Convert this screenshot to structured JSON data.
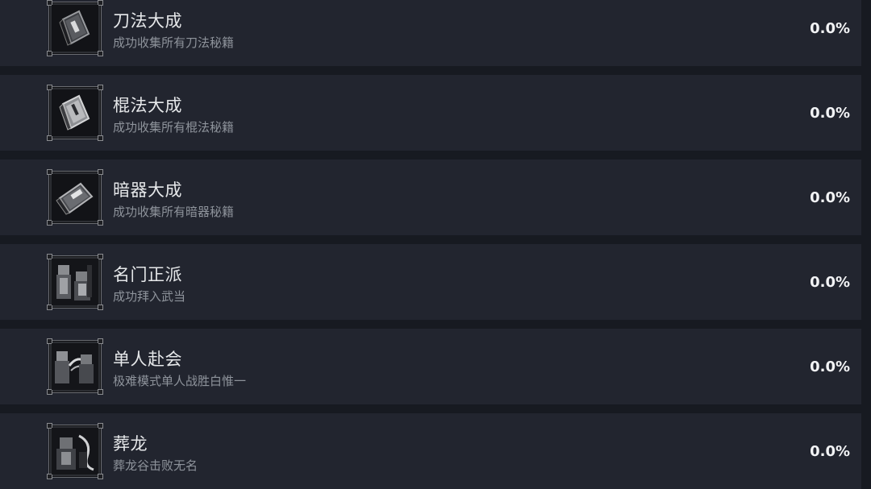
{
  "achievements": [
    {
      "title": "刀法大成",
      "description": "成功收集所有刀法秘籍",
      "percent": "0.0%",
      "icon": "blade-manual-icon"
    },
    {
      "title": "棍法大成",
      "description": "成功收集所有棍法秘籍",
      "percent": "0.0%",
      "icon": "staff-manual-icon"
    },
    {
      "title": "暗器大成",
      "description": "成功收集所有暗器秘籍",
      "percent": "0.0%",
      "icon": "hidden-weapon-manual-icon"
    },
    {
      "title": "名门正派",
      "description": "成功拜入武当",
      "percent": "0.0%",
      "icon": "sect-disciples-icon"
    },
    {
      "title": "单人赴会",
      "description": "极难模式单人战胜白惟一",
      "percent": "0.0%",
      "icon": "solo-duel-icon"
    },
    {
      "title": "葬龙",
      "description": "葬龙谷击败无名",
      "percent": "0.0%",
      "icon": "dragon-burial-icon"
    }
  ]
}
